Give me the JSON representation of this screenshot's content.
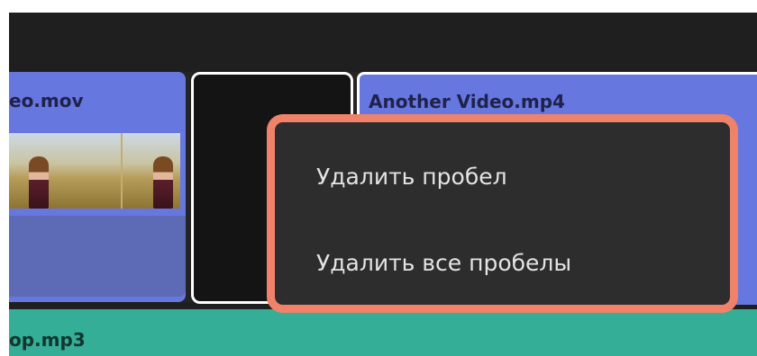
{
  "timeline": {
    "video_clip_1": {
      "title": "eo.mov"
    },
    "video_clip_2": {
      "title": "Another Video.mp4"
    },
    "audio_clip": {
      "title": "op.mp3"
    }
  },
  "context_menu": {
    "items": [
      {
        "label": "Удалить пробел"
      },
      {
        "label": "Удалить все пробелы"
      }
    ]
  },
  "colors": {
    "video_clip": "#6677e0",
    "audio_track": "#34ae96",
    "menu_highlight_border": "#f0826a",
    "menu_background": "#2d2d2d"
  }
}
